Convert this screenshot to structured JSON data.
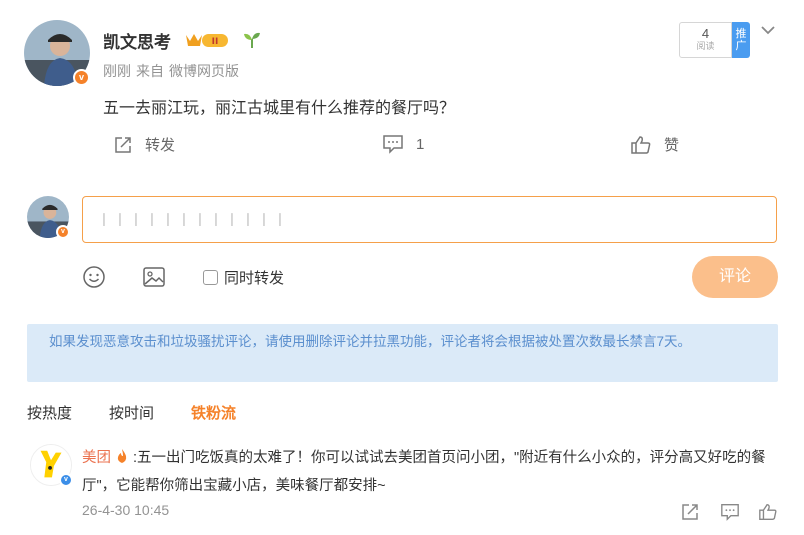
{
  "post": {
    "username": "凯文思考",
    "time": "刚刚",
    "source_prefix": "来自",
    "source": "微博网页版",
    "text": "五一去丽江玩，丽江古城里有什么推荐的餐厅吗？",
    "read_count": "4",
    "read_label": "阅读",
    "promote_label": "推广",
    "actions": {
      "repost": "转发",
      "comment_count": "1",
      "like": "赞"
    }
  },
  "composer": {
    "input_value": "丨丨丨丨丨丨丨丨丨丨丨丨",
    "repost_checkbox_label": "同时转发",
    "submit_label": "评论"
  },
  "notice": {
    "text": "如果发现恶意攻击和垃圾骚扰评论，请使用删除评论并拉黑功能，评论者将会根据被处置次数最长禁言7天。"
  },
  "sort_tabs": [
    {
      "label": "按热度"
    },
    {
      "label": "按时间"
    },
    {
      "label": "铁粉流"
    }
  ],
  "comment": {
    "username": "美团",
    "text": ":五一出门吃饭真的太难了！你可以试试去美团首页问小团，\"附近有什么小众的，评分高又好吃的餐厅\"，它能帮你筛出宝藏小店，美味餐厅都安排~",
    "time": "26-4-30 10:45"
  },
  "colors": {
    "accent": "#f5822a",
    "button_disabled": "#fbbf8b",
    "notice_bg": "#dbeaf8",
    "notice_text": "#5b8fce",
    "promote_bg": "#4a9cf0"
  },
  "icons": [
    "crown-badge-icon",
    "sprout-icon",
    "chevron-down-icon",
    "share-icon",
    "comment-icon",
    "like-icon",
    "emoji-icon",
    "image-icon",
    "fire-badge-icon"
  ]
}
